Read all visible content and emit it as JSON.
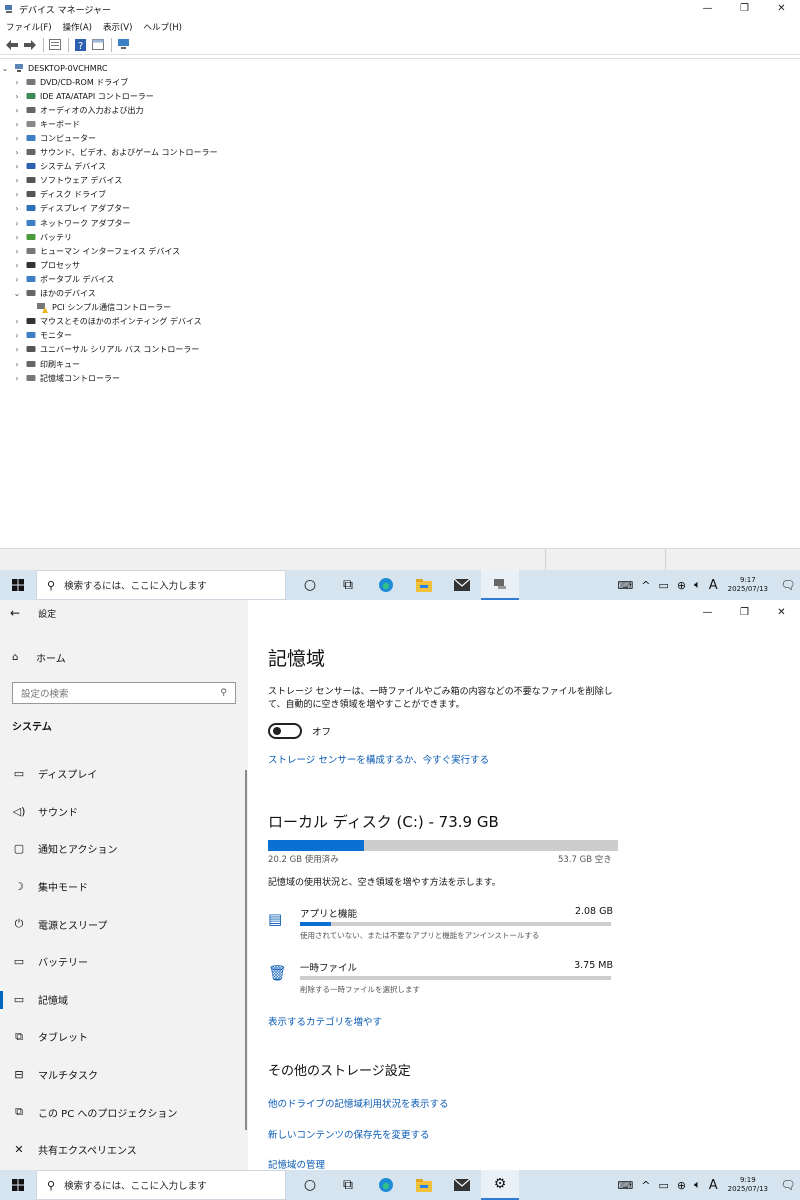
{
  "device_manager": {
    "title": "デバイス マネージャー",
    "menu": [
      "ファイル(F)",
      "操作(A)",
      "表示(V)",
      "ヘルプ(H)"
    ],
    "root": "DESKTOP-0VCHMRC",
    "tree": [
      {
        "label": "DVD/CD-ROM ドライブ",
        "icon": "disc-drive-icon"
      },
      {
        "label": "IDE ATA/ATAPI コントローラー",
        "icon": "ide-controller-icon"
      },
      {
        "label": "オーディオの入力および出力",
        "icon": "speaker-icon"
      },
      {
        "label": "キーボード",
        "icon": "keyboard-icon"
      },
      {
        "label": "コンピューター",
        "icon": "computer-icon"
      },
      {
        "label": "サウンド、ビデオ、およびゲーム コントローラー",
        "icon": "sound-icon"
      },
      {
        "label": "システム デバイス",
        "icon": "system-devices-icon"
      },
      {
        "label": "ソフトウェア デバイス",
        "icon": "software-device-icon"
      },
      {
        "label": "ディスク ドライブ",
        "icon": "disk-drive-icon"
      },
      {
        "label": "ディスプレイ アダプター",
        "icon": "display-adapter-icon"
      },
      {
        "label": "ネットワーク アダプター",
        "icon": "network-adapter-icon"
      },
      {
        "label": "バッテリ",
        "icon": "battery-icon"
      },
      {
        "label": "ヒューマン インターフェイス デバイス",
        "icon": "hid-icon"
      },
      {
        "label": "プロセッサ",
        "icon": "processor-icon"
      },
      {
        "label": "ポータブル デバイス",
        "icon": "portable-device-icon"
      },
      {
        "label": "ほかのデバイス",
        "icon": "other-devices-icon",
        "expanded": true
      },
      {
        "label": "PCI シンプル通信コントローラー",
        "icon": "unknown-device-warning-icon",
        "child": true
      },
      {
        "label": "マウスとそのほかのポインティング デバイス",
        "icon": "mouse-icon"
      },
      {
        "label": "モニター",
        "icon": "monitor-icon"
      },
      {
        "label": "ユニバーサル シリアル バス コントローラー",
        "icon": "usb-icon"
      },
      {
        "label": "印刷キュー",
        "icon": "printer-icon"
      },
      {
        "label": "記憶域コントローラー",
        "icon": "storage-controller-icon"
      }
    ]
  },
  "taskbar_top": {
    "search_placeholder": "検索するには、ここに入力します",
    "time": "9:17",
    "date": "2025/07/13",
    "ime": "A"
  },
  "taskbar_bottom": {
    "search_placeholder": "検索するには、ここに入力します",
    "time": "9:19",
    "date": "2025/07/13",
    "ime": "A"
  },
  "settings": {
    "title": "設定",
    "home": "ホーム",
    "search_placeholder": "設定の検索",
    "section": "システム",
    "nav": [
      {
        "label": "ディスプレイ",
        "icon": "display-icon"
      },
      {
        "label": "サウンド",
        "icon": "sound-icon"
      },
      {
        "label": "通知とアクション",
        "icon": "notifications-icon"
      },
      {
        "label": "集中モード",
        "icon": "focus-assist-icon"
      },
      {
        "label": "電源とスリープ",
        "icon": "power-icon"
      },
      {
        "label": "バッテリー",
        "icon": "battery-icon"
      },
      {
        "label": "記憶域",
        "icon": "storage-icon",
        "selected": true
      },
      {
        "label": "タブレット",
        "icon": "tablet-icon"
      },
      {
        "label": "マルチタスク",
        "icon": "multitasking-icon"
      },
      {
        "label": "この PC へのプロジェクション",
        "icon": "projection-icon"
      },
      {
        "label": "共有エクスペリエンス",
        "icon": "shared-experiences-icon"
      }
    ],
    "page_title": "記憶域",
    "sensor_desc": "ストレージ センサーは、一時ファイルやごみ箱の内容などの不要なファイルを削除して、自動的に空き領域を増やすことができます。",
    "toggle_label": "オフ",
    "toggle_on": false,
    "configure_link": "ストレージ センサーを構成するか、今すぐ実行する",
    "disk_title": "ローカル ディスク (C:) - 73.9 GB",
    "used_label": "20.2 GB 使用済み",
    "free_label": "53.7 GB 空き",
    "used_fraction": 0.273,
    "usage_desc": "記憶域の使用状況と、空き領域を増やす方法を示します。",
    "categories": [
      {
        "name": "アプリと機能",
        "size": "2.08 GB",
        "desc": "使用されていない、または不要なアプリと機能をアンインストールする",
        "fraction": 0.1,
        "icon": "apps-icon"
      },
      {
        "name": "一時ファイル",
        "size": "3.75 MB",
        "desc": "削除する一時ファイルを選択します",
        "fraction": 0.0,
        "icon": "trash-icon"
      }
    ],
    "more_categories_link": "表示するカテゴリを増やす",
    "other_heading": "その他のストレージ設定",
    "other_links": [
      "他のドライブの記憶域利用状況を表示する",
      "新しいコンテンツの保存先を変更する",
      "記憶域の管理"
    ]
  },
  "colors": {
    "accent": "#0a70d4",
    "taskbar": "#d6e4f0",
    "link": "#0a5bb5"
  }
}
